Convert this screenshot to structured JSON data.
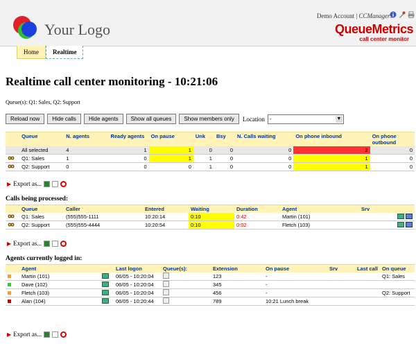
{
  "header": {
    "logo_text": "Your Logo",
    "account_text": "Demo Account",
    "account_sep": " | ",
    "account_role": "CCManagers",
    "brand": "QueueMetrics",
    "tagline": "call center monitor"
  },
  "tabs": [
    {
      "label": "Home"
    },
    {
      "label": "Realtime"
    }
  ],
  "page_title": "Realtime call center monitoring - 10:21:06",
  "queues_text": "Queue(s): Q1: Sales, Q2: Support",
  "toolbar": {
    "buttons": [
      "Reload now",
      "Hide calls",
      "Hide agents",
      "Show all queues",
      "Show members only"
    ],
    "location_label": "Location",
    "location_value": "-"
  },
  "export_label": "Export as...",
  "queue_table": {
    "headers": [
      "Queue",
      "N. agents",
      "Ready agents",
      "On pause",
      "Unk",
      "Bsy",
      "N. Calls waiting",
      "On phone inbound",
      "On phone outbound"
    ],
    "rows": [
      {
        "queue": "All selected",
        "n_agents": "4",
        "ready": "1",
        "pause": "1",
        "unk": "0",
        "bsy": "0",
        "waiting": "0",
        "inbound": "2",
        "outbound": "0"
      },
      {
        "queue": "Q1: Sales",
        "n_agents": "1",
        "ready": "0",
        "pause": "1",
        "unk": "1",
        "bsy": "0",
        "waiting": "0",
        "inbound": "1",
        "outbound": "0"
      },
      {
        "queue": "Q2: Support",
        "n_agents": "0",
        "ready": "0",
        "pause": "0",
        "unk": "1",
        "bsy": "0",
        "waiting": "0",
        "inbound": "1",
        "outbound": "0"
      }
    ]
  },
  "calls_section_title": "Calls being processed:",
  "calls_table": {
    "headers": [
      "Queue",
      "Caller",
      "Entered",
      "Waiting",
      "Duration",
      "Agent",
      "Srv"
    ],
    "rows": [
      {
        "queue": "Q1: Sales",
        "caller": "(555)555-1111",
        "entered": "10:20:14",
        "waiting": "0:10",
        "duration": "0:42",
        "agent": "Martin (101)",
        "srv": ""
      },
      {
        "queue": "Q2: Support",
        "caller": "(555)555-4444",
        "entered": "10:20:54",
        "waiting": "0:10",
        "duration": "0:02",
        "agent": "Fletch (103)",
        "srv": ""
      }
    ]
  },
  "agents_section_title": "Agents currently logged in:",
  "agents_table": {
    "headers": [
      "Agent",
      "Last logon",
      "Queue(s):",
      "Extension",
      "On pause",
      "Srv",
      "Last call",
      "On queue"
    ],
    "rows": [
      {
        "color": "#ff9933",
        "agent": "Martin (101)",
        "logon": "06/05 - 10:20:04",
        "ext": "123",
        "pause": "-",
        "srv": "",
        "last_call": "",
        "on_queue": "Q1: Sales"
      },
      {
        "color": "#33cc33",
        "agent": "Dave (102)",
        "logon": "06/05 - 10:20:04",
        "ext": "345",
        "pause": "-",
        "srv": "",
        "last_call": "",
        "on_queue": ""
      },
      {
        "color": "#ff9933",
        "agent": "Fletch (103)",
        "logon": "06/05 - 10:20:04",
        "ext": "456",
        "pause": "-",
        "srv": "",
        "last_call": "",
        "on_queue": "Q2: Support"
      },
      {
        "color": "#cc0000",
        "agent": "Alan (104)",
        "logon": "06/05 - 10:20:44",
        "ext": "789",
        "pause": "10:21 Lunch break",
        "srv": "",
        "last_call": "",
        "on_queue": ""
      }
    ]
  },
  "icons": {
    "header": [
      "info-icon",
      "settings-icon",
      "print-icon"
    ],
    "export": [
      "excel-icon",
      "document-icon",
      "stop-icon"
    ],
    "row": [
      "spy-icon"
    ]
  }
}
